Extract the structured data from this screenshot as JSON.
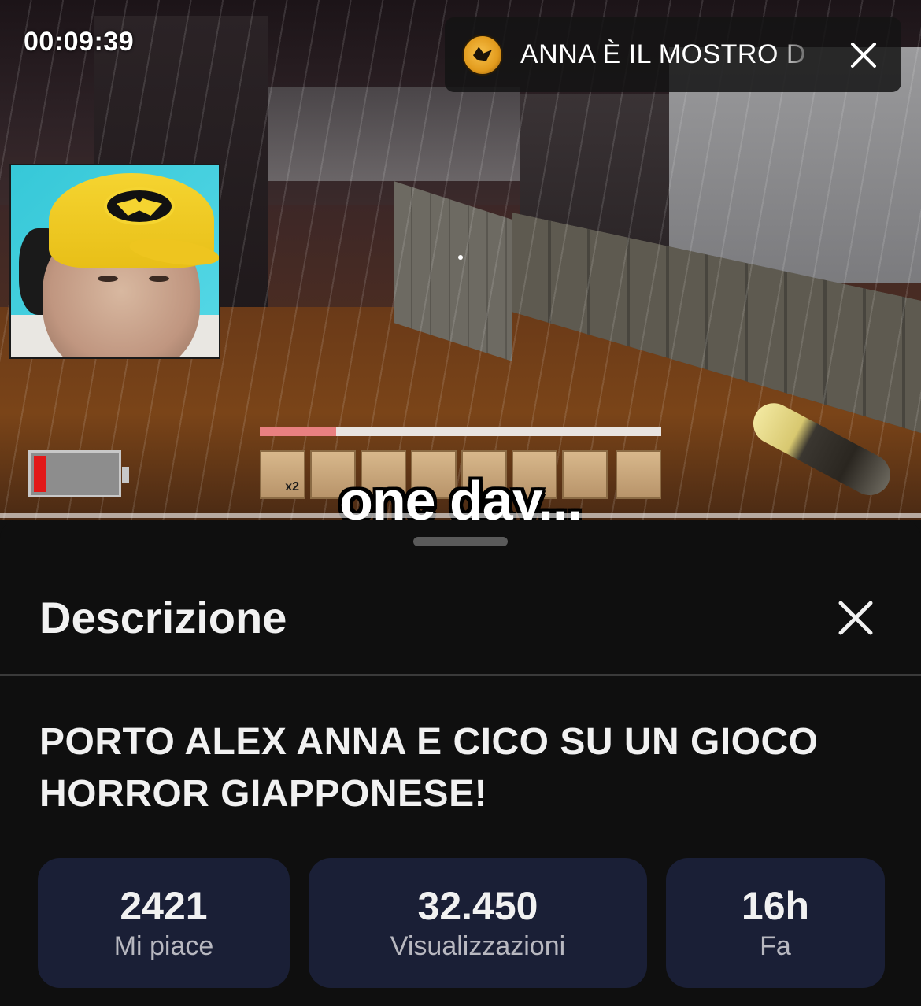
{
  "video": {
    "timestamp": "00:09:39",
    "caption": "one day...",
    "battery_level": 0.15,
    "health_level": 0.19,
    "hotbar": [
      {
        "count": "x2"
      },
      {
        "count": ""
      },
      {
        "count": ""
      },
      {
        "count": ""
      },
      {
        "count": ""
      },
      {
        "count": ""
      },
      {
        "count": ""
      },
      {
        "count": ""
      }
    ]
  },
  "title_overlay": {
    "text": "ANNA È IL MOSTRO D",
    "avatar_icon": "channel-logo"
  },
  "description_sheet": {
    "heading": "Descrizione",
    "video_title": "PORTO ALEX ANNA E CICO SU UN GIOCO HORROR GIAPPONESE!",
    "stats": [
      {
        "value": "2421",
        "label": "Mi piace"
      },
      {
        "value": "32.450",
        "label": "Visualizzazioni"
      },
      {
        "value": "16h",
        "label": "Fa"
      }
    ]
  },
  "colors": {
    "sheet_background": "#0f0f0f",
    "stat_background": "#1a1f36",
    "battery_fill": "#e21818"
  }
}
